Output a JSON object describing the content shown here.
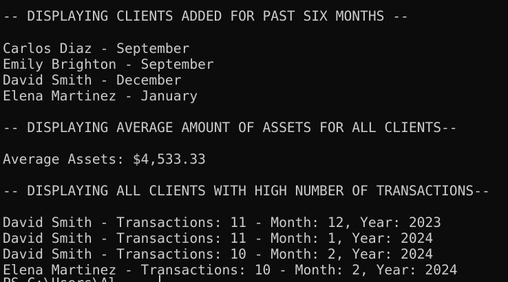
{
  "terminal": {
    "section1_header": "-- DISPLAYING CLIENTS ADDED FOR PAST SIX MONTHS --",
    "recent_clients": [
      "Carlos Diaz - September",
      "Emily Brighton - September",
      "David Smith - December",
      "Elena Martinez - January"
    ],
    "section2_header": "-- DISPLAYING AVERAGE AMOUNT OF ASSETS FOR ALL CLIENTS--",
    "average_assets": "Average Assets: $4,533.33",
    "section3_header": "-- DISPLAYING ALL CLIENTS WITH HIGH NUMBER OF TRANSACTIONS--",
    "transactions": [
      "David Smith - Transactions: 11 - Month: 12, Year: 2023",
      "David Smith - Transactions: 11 - Month: 1, Year: 2024",
      "David Smith - Transactions: 10 - Month: 2, Year: 2024",
      "Elena Martinez - Transactions: 10 - Month: 2, Year: 2024"
    ],
    "prompt": "PS C:\\Users\\Al"
  }
}
